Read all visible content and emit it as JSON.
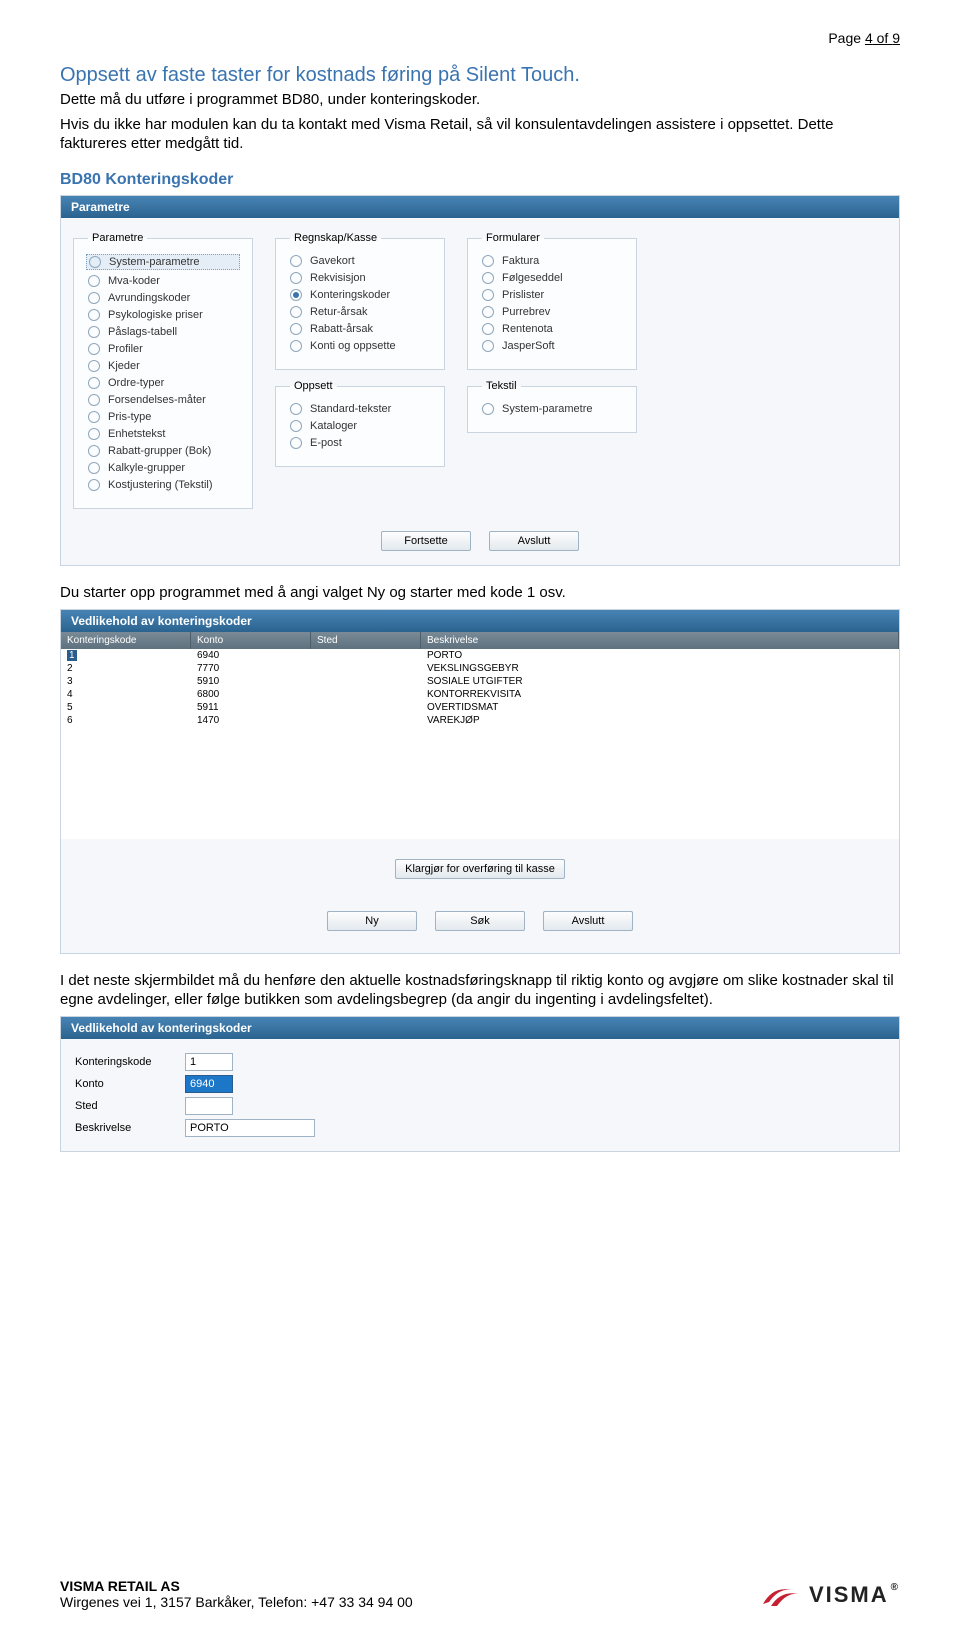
{
  "page_number": {
    "prefix": "Page ",
    "current": "4",
    "of": " of ",
    "total": "9"
  },
  "title": "Oppsett av faste taster for kostnads føring på Silent Touch.",
  "body1": "Dette må du utføre i programmet BD80, under konteringskoder.",
  "body2": "Hvis du ikke har modulen kan du ta kontakt med Visma Retail, så vil konsulentavdelingen assistere i oppsettet. Dette faktureres etter medgått tid.",
  "subhead": "BD80 Konteringskoder",
  "panel1_title": "Parametre",
  "groups": {
    "parametre": {
      "legend": "Parametre",
      "items": [
        "System-parametre",
        "Mva-koder",
        "Avrundingskoder",
        "Psykologiske priser",
        "Påslags-tabell",
        "Profiler",
        "Kjeder",
        "Ordre-typer",
        "Forsendelses-måter",
        "Pris-type",
        "Enhetstekst",
        "Rabatt-grupper (Bok)",
        "Kalkyle-grupper",
        "Kostjustering (Tekstil)"
      ]
    },
    "regnskap": {
      "legend": "Regnskap/Kasse",
      "items": [
        "Gavekort",
        "Rekvisisjon",
        "Konteringskoder",
        "Retur-årsak",
        "Rabatt-årsak",
        "Konti og oppsette"
      ]
    },
    "oppsett": {
      "legend": "Oppsett",
      "items": [
        "Standard-tekster",
        "Kataloger",
        "E-post"
      ]
    },
    "formularer": {
      "legend": "Formularer",
      "items": [
        "Faktura",
        "Følgeseddel",
        "Prislister",
        "Purrebrev",
        "Rentenota",
        "JasperSoft"
      ]
    },
    "tekstil": {
      "legend": "Tekstil",
      "items": [
        "System-parametre"
      ]
    }
  },
  "btn_continue": "Fortsette",
  "btn_exit": "Avslutt",
  "body3": "Du starter opp programmet med å angi valget Ny og starter med kode 1 osv.",
  "panel2_title": "Vedlikehold av konteringskoder",
  "cols": {
    "c1": "Konteringskode",
    "c2": "Konto",
    "c3": "Sted",
    "c4": "Beskrivelse"
  },
  "rows": [
    {
      "kode": "1",
      "konto": "6940",
      "sted": "",
      "beskr": "PORTO"
    },
    {
      "kode": "2",
      "konto": "7770",
      "sted": "",
      "beskr": "VEKSLINGSGEBYR"
    },
    {
      "kode": "3",
      "konto": "5910",
      "sted": "",
      "beskr": "SOSIALE UTGIFTER"
    },
    {
      "kode": "4",
      "konto": "6800",
      "sted": "",
      "beskr": "KONTORREKVISITA"
    },
    {
      "kode": "5",
      "konto": "5911",
      "sted": "",
      "beskr": "OVERTIDSMAT"
    },
    {
      "kode": "6",
      "konto": "1470",
      "sted": "",
      "beskr": "VAREKJØP"
    }
  ],
  "btn_prepare": "Klargjør for overføring til kasse",
  "btn_new": "Ny",
  "btn_search": "Søk",
  "body4": "I det neste skjermbildet må du henføre den aktuelle kostnadsføringsknapp til riktig konto og avgjøre om slike kostnader skal til egne avdelinger, eller følge butikken som avdelingsbegrep (da angir du ingenting i avdelingsfeltet).",
  "panel3_title": "Vedlikehold av konteringskoder",
  "edit": {
    "konteringskode_label": "Konteringskode",
    "konteringskode": "1",
    "konto_label": "Konto",
    "konto": "6940",
    "sted_label": "Sted",
    "sted": "",
    "beskrivelse_label": "Beskrivelse",
    "beskrivelse": "PORTO"
  },
  "footer": {
    "company": "VISMA RETAIL AS",
    "address": "Wirgenes vei 1, 3157 Barkåker, Telefon: +47 33 34 94 00",
    "logo": "VISMA"
  }
}
